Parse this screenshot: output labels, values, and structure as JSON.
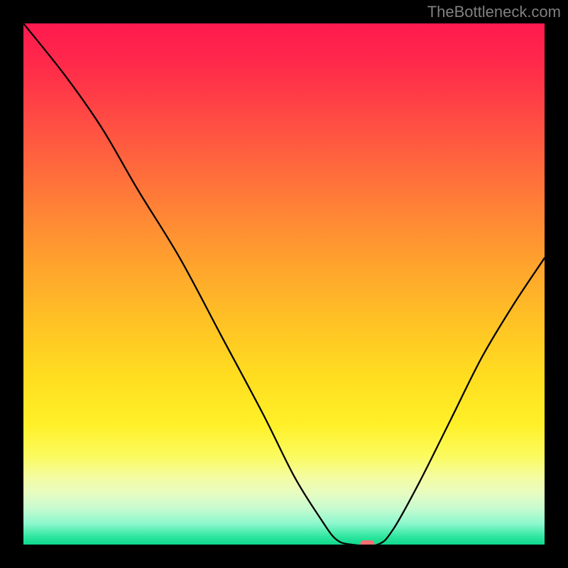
{
  "attribution": "TheBottleneck.com",
  "chart_data": {
    "type": "line",
    "title": "",
    "xlabel": "",
    "ylabel": "",
    "xlim": [
      0,
      100
    ],
    "ylim": [
      0,
      100
    ],
    "grid": false,
    "legend": false,
    "curve": [
      {
        "x": 0,
        "y": 100
      },
      {
        "x": 8,
        "y": 90
      },
      {
        "x": 15,
        "y": 80
      },
      {
        "x": 22,
        "y": 68
      },
      {
        "x": 30,
        "y": 55
      },
      {
        "x": 38,
        "y": 40
      },
      {
        "x": 46,
        "y": 25
      },
      {
        "x": 52,
        "y": 13
      },
      {
        "x": 57,
        "y": 5
      },
      {
        "x": 60,
        "y": 1
      },
      {
        "x": 63,
        "y": 0
      },
      {
        "x": 68,
        "y": 0
      },
      {
        "x": 71,
        "y": 3
      },
      {
        "x": 76,
        "y": 12
      },
      {
        "x": 82,
        "y": 24
      },
      {
        "x": 88,
        "y": 36
      },
      {
        "x": 94,
        "y": 46
      },
      {
        "x": 100,
        "y": 55
      }
    ],
    "marker": {
      "x": 66,
      "y": 0,
      "color": "#ff6f72"
    },
    "gradient_colors": {
      "top": "#ff1a4e",
      "mid": "#ffde20",
      "bottom": "#0fd98b"
    }
  }
}
